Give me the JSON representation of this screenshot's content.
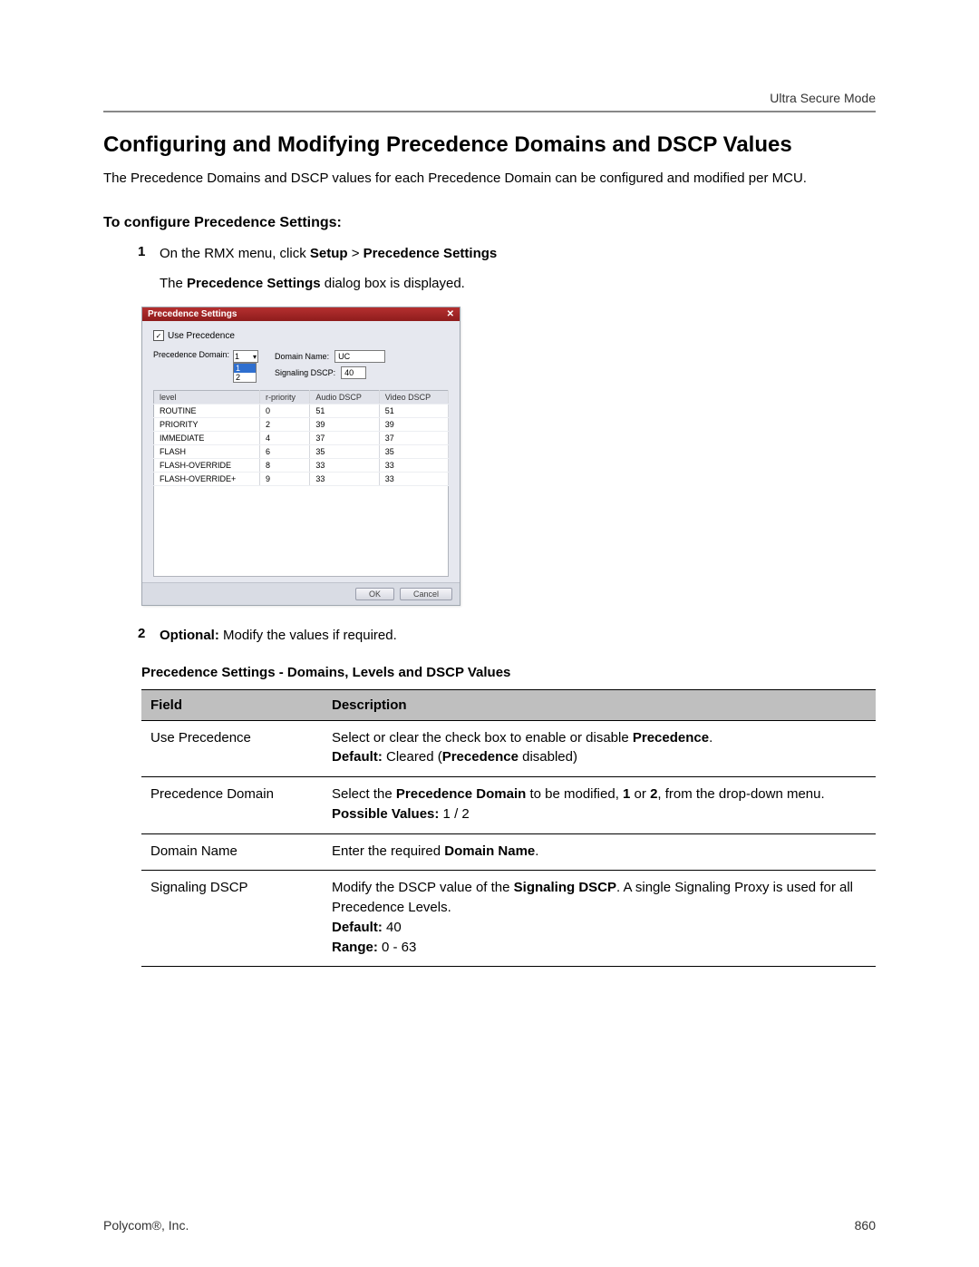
{
  "header": {
    "section": "Ultra Secure Mode"
  },
  "title": "Configuring and Modifying Precedence Domains and DSCP Values",
  "intro": "The Precedence Domains and DSCP values for each Precedence Domain can be configured and modified per MCU.",
  "subheading": "To configure Precedence Settings:",
  "steps": {
    "s1_num": "1",
    "s1_pre": "On the RMX menu, click ",
    "s1_b1": "Setup",
    "s1_mid": " > ",
    "s1_b2": "Precedence Settings",
    "s1_sub_pre": "The ",
    "s1_sub_b": "Precedence Settings",
    "s1_sub_post": " dialog box is displayed.",
    "s2_num": "2",
    "s2_b": "Optional:",
    "s2_post": " Modify the values if required."
  },
  "dialog": {
    "title": "Precedence Settings",
    "use_precedence_label": "Use Precedence",
    "precedence_domain_label": "Precedence Domain:",
    "domain_selected": "1",
    "domain_opt1": "1",
    "domain_opt2": "2",
    "domain_name_label": "Domain Name:",
    "domain_name_value": "UC",
    "signaling_label": "Signaling DSCP:",
    "signaling_value": "40",
    "cols": {
      "c1": "level",
      "c2": "r-priority",
      "c3": "Audio DSCP",
      "c4": "Video DSCP"
    },
    "rows": [
      {
        "a": "ROUTINE",
        "b": "0",
        "c": "51",
        "d": "51"
      },
      {
        "a": "PRIORITY",
        "b": "2",
        "c": "39",
        "d": "39"
      },
      {
        "a": "IMMEDIATE",
        "b": "4",
        "c": "37",
        "d": "37"
      },
      {
        "a": "FLASH",
        "b": "6",
        "c": "35",
        "d": "35"
      },
      {
        "a": "FLASH-OVERRIDE",
        "b": "8",
        "c": "33",
        "d": "33"
      },
      {
        "a": "FLASH-OVERRIDE+",
        "b": "9",
        "c": "33",
        "d": "33"
      }
    ],
    "ok": "OK",
    "cancel": "Cancel"
  },
  "table_title": "Precedence Settings - Domains, Levels and DSCP Values",
  "ref_head": {
    "field": "Field",
    "desc": "Description"
  },
  "rows": {
    "r1_field": "Use Precedence",
    "r1_line1_pre": "Select or clear the check box to enable or disable ",
    "r1_line1_b": "Precedence",
    "r1_line1_post": ".",
    "r1_line2_b1": "Default:",
    "r1_line2_mid": " Cleared (",
    "r1_line2_b2": "Precedence",
    "r1_line2_post": " disabled)",
    "r2_field": "Precedence Domain",
    "r2_line1_pre": "Select the ",
    "r2_line1_b1": "Precedence Domain",
    "r2_line1_mid1": " to be modified, ",
    "r2_line1_b2": "1",
    "r2_line1_mid2": " or ",
    "r2_line1_b3": "2",
    "r2_line1_post": ", from the drop-down menu.",
    "r2_line2_b": "Possible Values:",
    "r2_line2_post": " 1 / 2",
    "r3_field": "Domain Name",
    "r3_line1_pre": "Enter the required ",
    "r3_line1_b": "Domain Name",
    "r3_line1_post": ".",
    "r4_field": "Signaling DSCP",
    "r4_line1_pre": "Modify the DSCP value of the ",
    "r4_line1_b": "Signaling DSCP",
    "r4_line1_post": ". A single Signaling Proxy is used for all Precedence Levels.",
    "r4_line2_b": "Default:",
    "r4_line2_post": " 40",
    "r4_line3_b": "Range:",
    "r4_line3_post": " 0 - 63"
  },
  "footer": {
    "left": "Polycom®, Inc.",
    "right": "860"
  }
}
